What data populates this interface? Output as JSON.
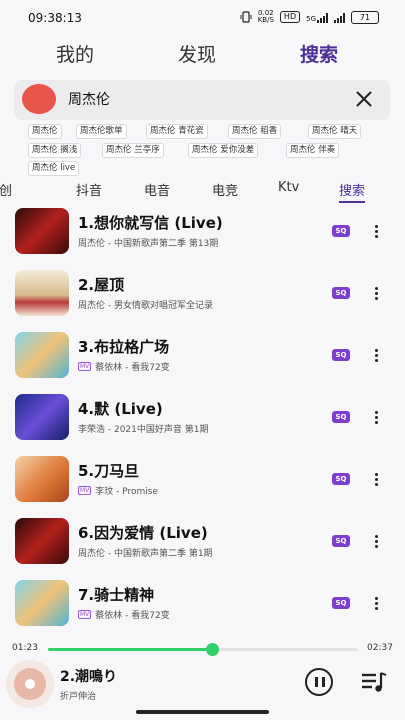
{
  "status_bar": {
    "time": "09:38:13",
    "net_speed": "0.02",
    "net_unit": "KB/S",
    "hd_label": "HD",
    "net_type": "5G",
    "battery": "71"
  },
  "top_tabs": [
    {
      "label": "我的",
      "active": false
    },
    {
      "label": "发现",
      "active": false
    },
    {
      "label": "搜索",
      "active": true
    }
  ],
  "search": {
    "value": "周杰伦"
  },
  "suggestions": [
    "周杰伦",
    "周杰伦歌单",
    "周杰伦 青花瓷",
    "周杰伦 稻香",
    "周杰伦 晴天",
    "周杰伦 搁浅",
    "周杰伦 兰亭序",
    "周杰伦 爱你没差",
    "周杰伦 伴奏",
    "周杰伦 live"
  ],
  "categories": [
    {
      "label": "原创",
      "active": false
    },
    {
      "label": "抖音",
      "active": false
    },
    {
      "label": "电音",
      "active": false
    },
    {
      "label": "电竞",
      "active": false
    },
    {
      "label": "Ktv",
      "active": false
    },
    {
      "label": "搜索",
      "active": true
    }
  ],
  "songs": [
    {
      "title": "1.想你就写信 (Live)",
      "subtitle": "周杰伦 - 中国新歌声第二季 第13期",
      "mv": false,
      "quality": "SQ"
    },
    {
      "title": "2.屋顶",
      "subtitle": "周杰伦 - 男女情歌对唱冠军全记录",
      "mv": false,
      "quality": "SQ"
    },
    {
      "title": "3.布拉格广场",
      "subtitle": "蔡依林 - 看我72变",
      "mv": true,
      "quality": "SQ"
    },
    {
      "title": "4.默 (Live)",
      "subtitle": "李荣浩 - 2021中国好声音 第1期",
      "mv": false,
      "quality": "SQ"
    },
    {
      "title": "5.刀马旦",
      "subtitle": "李玟 - Promise",
      "mv": true,
      "quality": "SQ"
    },
    {
      "title": "6.因为爱情 (Live)",
      "subtitle": "周杰伦 - 中国新歌声第二季 第1期",
      "mv": false,
      "quality": "SQ"
    },
    {
      "title": "7.骑士精神",
      "subtitle": "蔡依林 - 看我72变",
      "mv": true,
      "quality": "SQ"
    }
  ],
  "mv_label": "MV",
  "playback": {
    "current": "01:23",
    "total": "02:37",
    "progress": 0.53
  },
  "now_playing": {
    "title": "2.潮鳴り",
    "artist": "折戸伸治"
  },
  "colors": {
    "accent": "#4c2f97",
    "progress": "#2fcf6a",
    "sq_badge": "#7e3fd1",
    "avatar": "#e9544c"
  }
}
